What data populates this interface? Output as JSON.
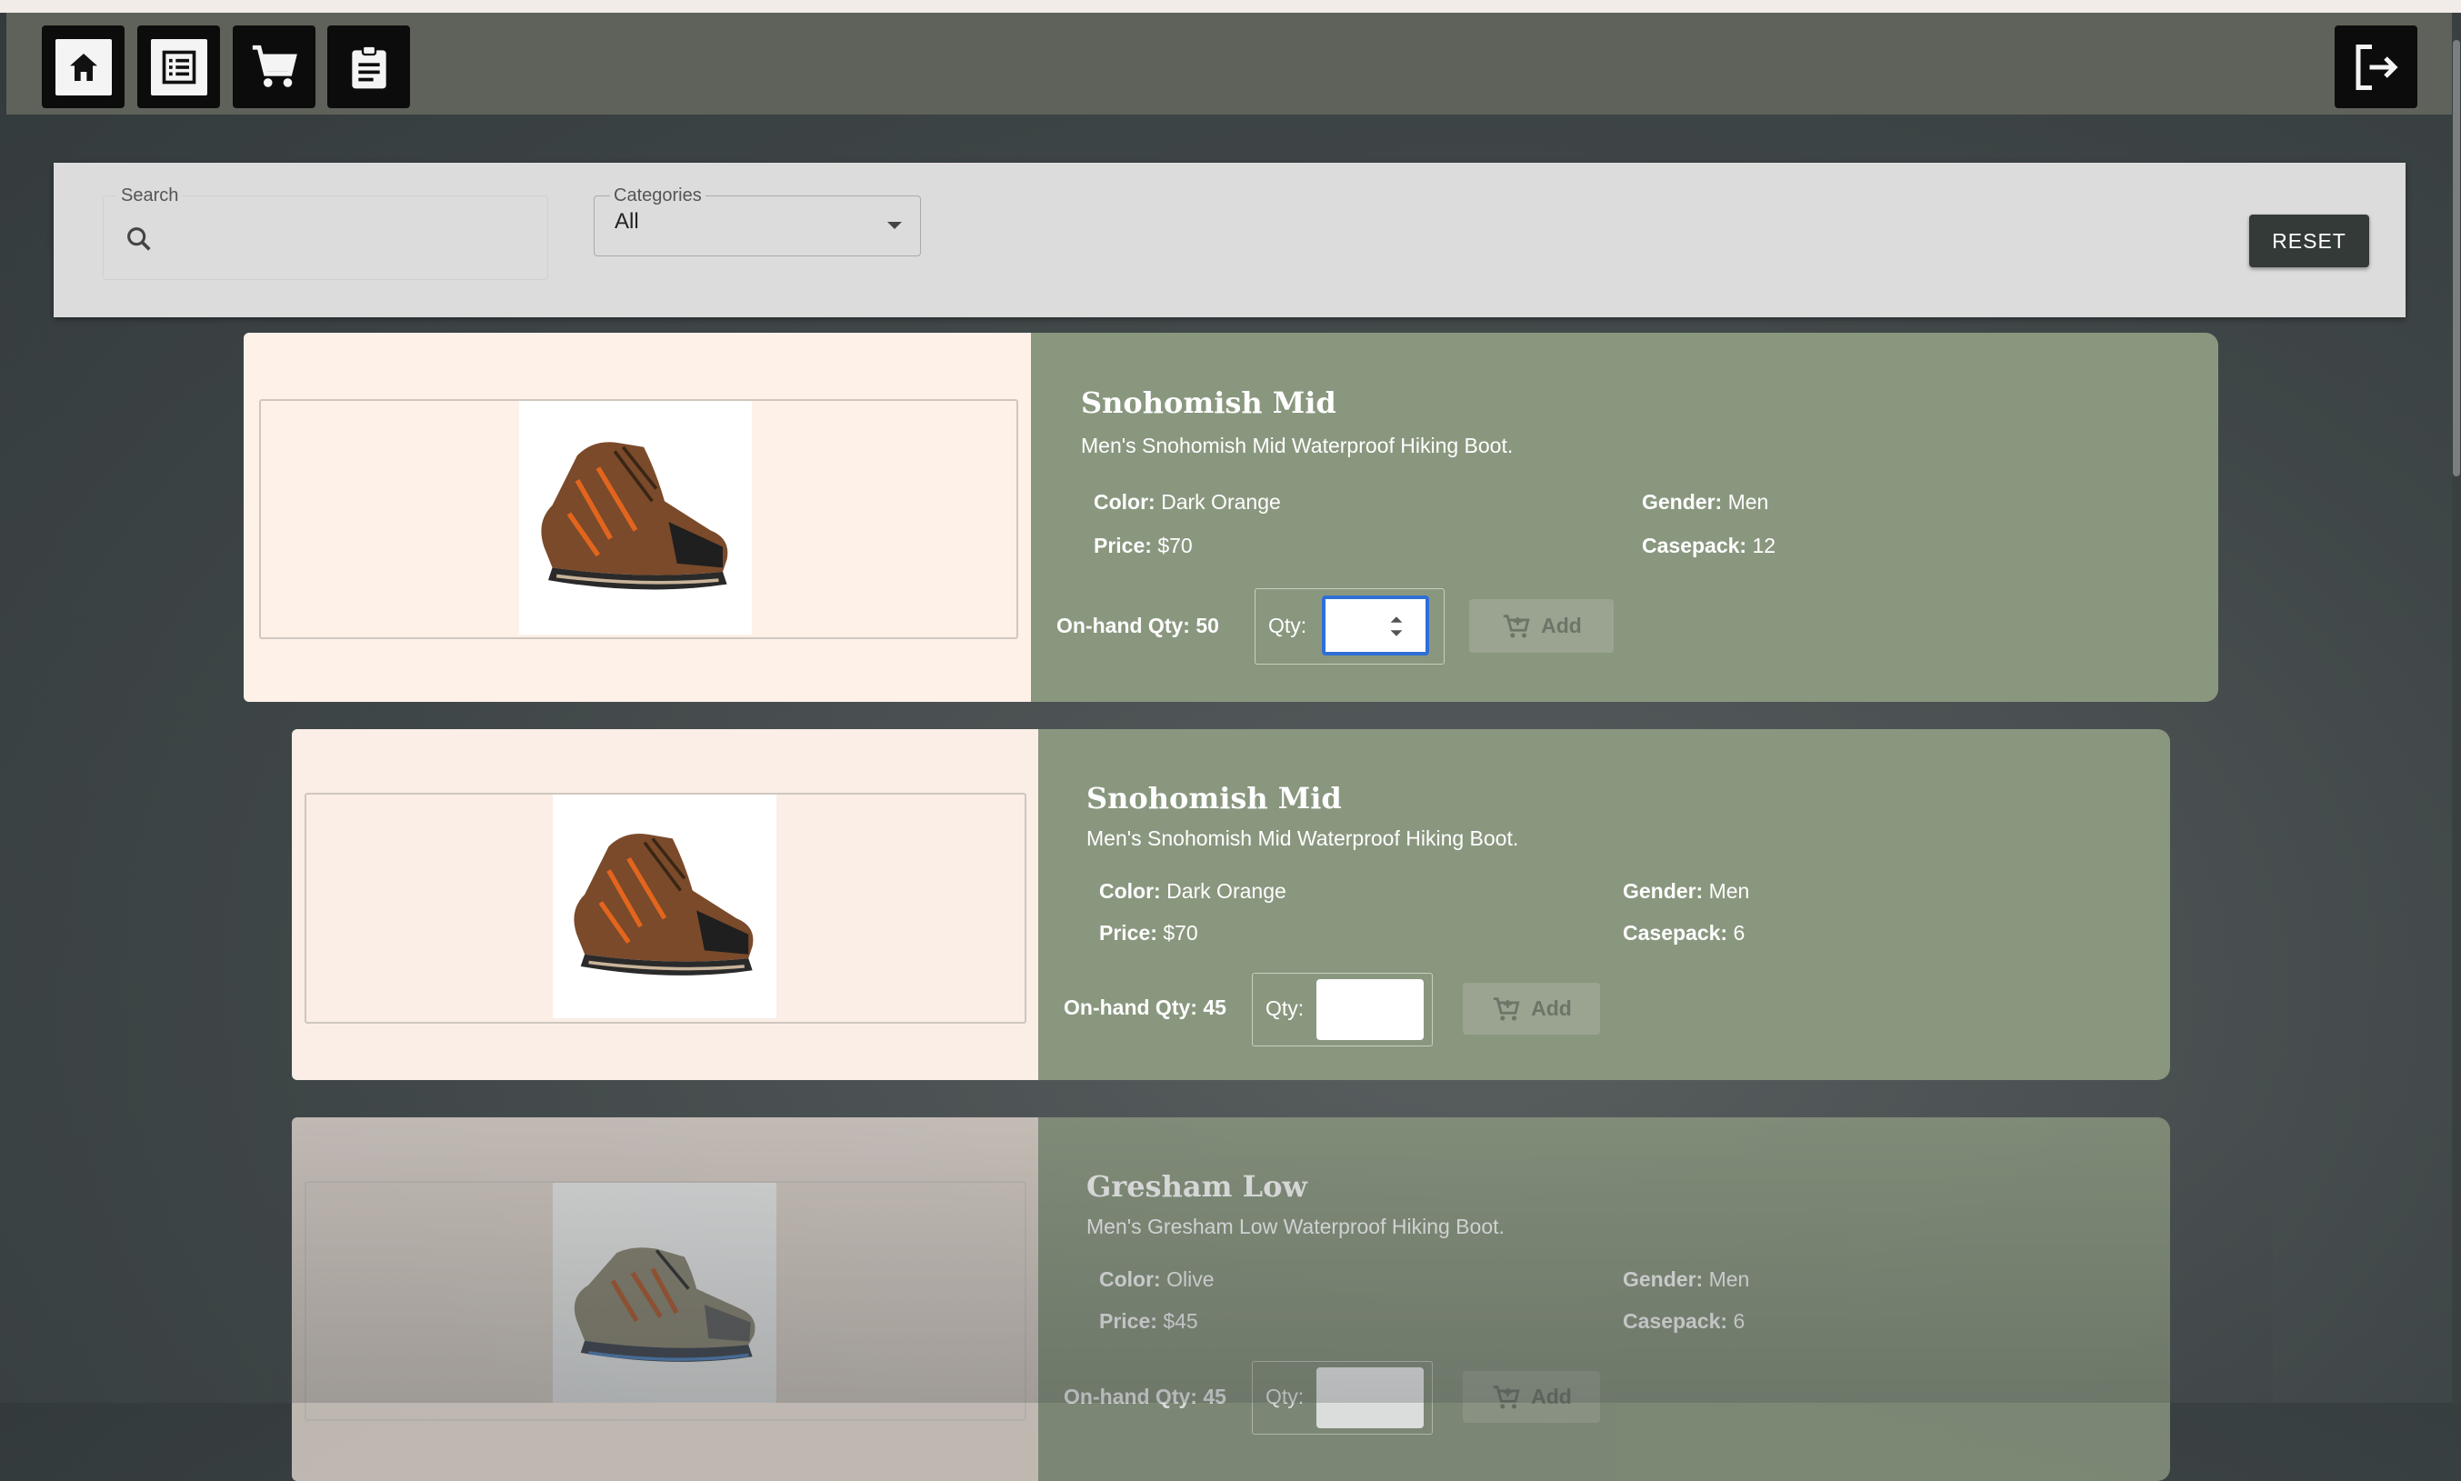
{
  "nav": {
    "items": [
      {
        "name": "home-icon"
      },
      {
        "name": "list-icon"
      },
      {
        "name": "cart-icon"
      },
      {
        "name": "clipboard-icon"
      }
    ],
    "logout_icon": "logout-icon"
  },
  "filters": {
    "search_label": "Search",
    "search_value": "",
    "categories_label": "Categories",
    "categories_value": "All",
    "reset_label": "RESET"
  },
  "products": [
    {
      "title": "Snohomish Mid",
      "description": "Men's Snohomish Mid Waterproof Hiking Boot.",
      "color_label": "Color:",
      "color": "Dark Orange",
      "price_label": "Price:",
      "price": "$70",
      "gender_label": "Gender:",
      "gender": "Men",
      "casepack_label": "Casepack:",
      "casepack": "12",
      "onhand": "On-hand Qty: 50",
      "qty_label": "Qty:",
      "qty_value": "",
      "add_label": "Add"
    },
    {
      "title": "Snohomish Mid",
      "description": "Men's Snohomish Mid Waterproof Hiking Boot.",
      "color_label": "Color:",
      "color": "Dark Orange",
      "price_label": "Price:",
      "price": "$70",
      "gender_label": "Gender:",
      "gender": "Men",
      "casepack_label": "Casepack:",
      "casepack": "6",
      "onhand": "On-hand Qty: 45",
      "qty_label": "Qty:",
      "qty_value": "",
      "add_label": "Add"
    },
    {
      "title": "Gresham Low",
      "description": "Men's Gresham Low Waterproof Hiking Boot.",
      "color_label": "Color:",
      "color": "Olive",
      "price_label": "Price:",
      "price": "$45",
      "gender_label": "Gender:",
      "gender": "Men",
      "casepack_label": "Casepack:",
      "casepack": "6",
      "onhand": "On-hand Qty: 45",
      "qty_label": "Qty:",
      "qty_value": "",
      "add_label": "Add"
    }
  ],
  "colors": {
    "topbar": "#5f625a",
    "card_info": "#8a977f",
    "card_image": "#fdf1e8",
    "reset_button": "#333a38",
    "focus_outline": "#2f6fd6"
  }
}
